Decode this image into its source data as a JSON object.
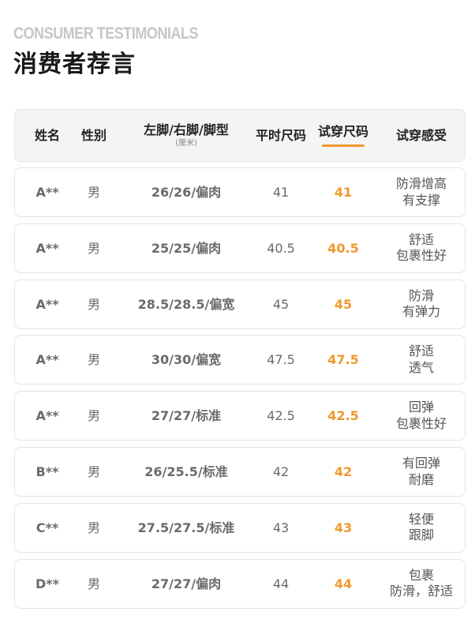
{
  "header": {
    "subtitle": "CONSUMER TESTIMONIALS",
    "title": "消费者荐言"
  },
  "table": {
    "columns": {
      "name": "姓名",
      "gender": "性别",
      "foot": "左脚/右脚/脚型",
      "foot_note": "(厘米)",
      "usual_size": "平时尺码",
      "trial_size": "试穿尺码",
      "feeling": "试穿感受"
    },
    "accent_color": "#f0982a",
    "rows": [
      {
        "name": "A**",
        "gender": "男",
        "foot": "26/26/偏肉",
        "usual": "41",
        "trial": "41",
        "feel1": "防滑增高",
        "feel2": "有支撑"
      },
      {
        "name": "A**",
        "gender": "男",
        "foot": "25/25/偏肉",
        "usual": "40.5",
        "trial": "40.5",
        "feel1": "舒适",
        "feel2": "包裹性好"
      },
      {
        "name": "A**",
        "gender": "男",
        "foot": "28.5/28.5/偏宽",
        "usual": "45",
        "trial": "45",
        "feel1": "防滑",
        "feel2": "有弹力"
      },
      {
        "name": "A**",
        "gender": "男",
        "foot": "30/30/偏宽",
        "usual": "47.5",
        "trial": "47.5",
        "feel1": "舒适",
        "feel2": "透气"
      },
      {
        "name": "A**",
        "gender": "男",
        "foot": "27/27/标准",
        "usual": "42.5",
        "trial": "42.5",
        "feel1": "回弹",
        "feel2": "包裹性好"
      },
      {
        "name": "B**",
        "gender": "男",
        "foot": "26/25.5/标准",
        "usual": "42",
        "trial": "42",
        "feel1": "有回弹",
        "feel2": "耐磨"
      },
      {
        "name": "C**",
        "gender": "男",
        "foot": "27.5/27.5/标准",
        "usual": "43",
        "trial": "43",
        "feel1": "轻便",
        "feel2": "跟脚"
      },
      {
        "name": "D**",
        "gender": "男",
        "foot": "27/27/偏肉",
        "usual": "44",
        "trial": "44",
        "feel1": "包裹",
        "feel2": "防滑，舒适"
      }
    ]
  }
}
